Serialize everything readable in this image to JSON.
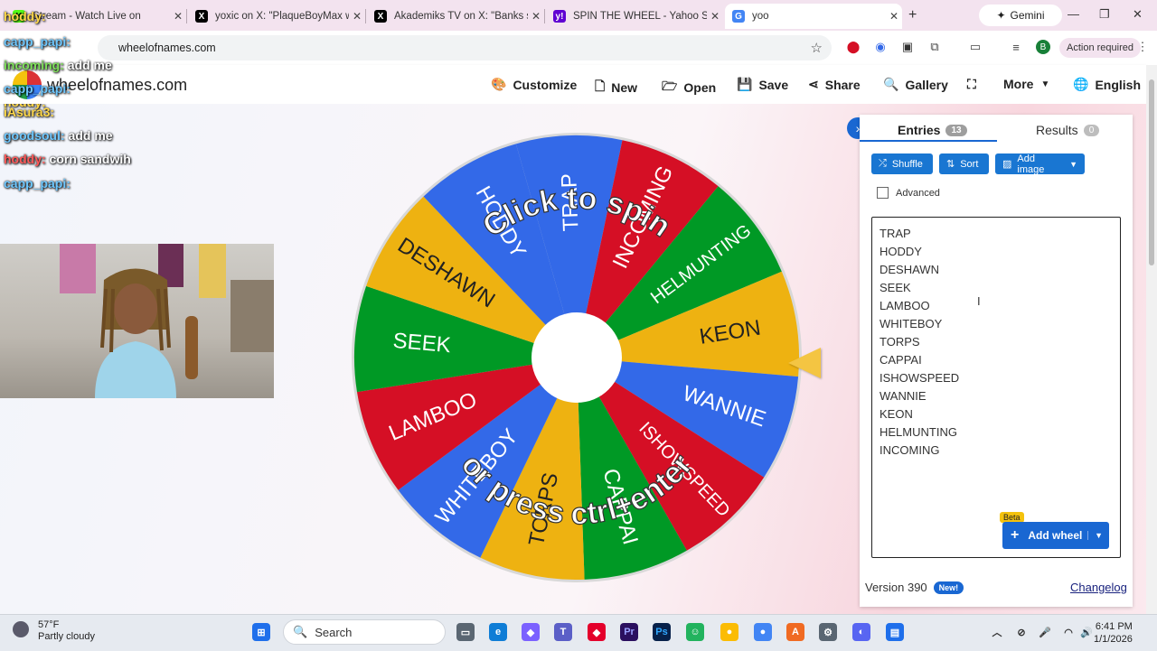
{
  "tabs": [
    {
      "title": "Stream - Watch Live on",
      "favicon": "K",
      "color": "#53fc18"
    },
    {
      "title": "yoxic on X: \"PlaqueBoyMax was",
      "favicon": "X",
      "color": "#000000"
    },
    {
      "title": "Akademiks TV on X: \"Banks spe",
      "favicon": "X",
      "color": "#000000"
    },
    {
      "title": "SPIN THE WHEEL - Yahoo Searc",
      "favicon": "y!",
      "color": "#6001d2"
    },
    {
      "title": "yoo",
      "favicon": "G",
      "color": "#4285f4"
    }
  ],
  "gemini_label": "Gemini",
  "url": "wheelofnames.com",
  "action_required": "Action required",
  "profile_initial": "B",
  "site": {
    "brand": "wheelofnames.com"
  },
  "menu": {
    "customize": "Customize",
    "new": "New",
    "open": "Open",
    "save": "Save",
    "share": "Share",
    "gallery": "Gallery",
    "more": "More",
    "language": "English"
  },
  "chat": [
    {
      "user": "hoddy:",
      "msg": ""
    },
    {
      "user": "capp_papi:",
      "msg": ""
    },
    {
      "user": "incoming:",
      "msg": "add me"
    },
    {
      "user": "capp_papi:",
      "msg": ""
    },
    {
      "user": "iAsura3:",
      "msg": ""
    },
    {
      "user": "goodsoul:",
      "msg": "add me"
    },
    {
      "user": "hoddy:",
      "msg": "corn sandwih"
    },
    {
      "user": "capp_papi:",
      "msg": ""
    }
  ],
  "wheel": {
    "overlay_top": "Click to spin",
    "overlay_bottom": "or press ctrl+enter",
    "segments": [
      "TRAP",
      "INCOMING",
      "HELMUNTING",
      "KEON",
      "WANNIE",
      "ISHOWSPEED",
      "CAPPAI",
      "TORPS",
      "WHITEBOY",
      "LAMBOO",
      "SEEK",
      "DESHAWN",
      "HODDY"
    ],
    "colors": [
      "#3369e8",
      "#d50f25",
      "#009925",
      "#eeb211"
    ]
  },
  "panel": {
    "entries_tab": "Entries",
    "entries_count": "13",
    "results_tab": "Results",
    "results_count": "0",
    "shuffle": "Shuffle",
    "sort": "Sort",
    "add_image": "Add image",
    "advanced": "Advanced",
    "entries": [
      "TRAP",
      "HODDY",
      "DESHAWN",
      "SEEK",
      "LAMBOO",
      "WHITEBOY",
      "TORPS",
      "CAPPAI",
      "ISHOWSPEED",
      "WANNIE",
      "KEON",
      "HELMUNTING",
      "INCOMING"
    ],
    "beta": "Beta",
    "add_wheel": "Add wheel",
    "version": "Version 390",
    "new_badge": "New!",
    "changelog": "Changelog"
  },
  "taskbar": {
    "temp": "57°F",
    "condition": "Partly cloudy",
    "search": "Search",
    "time": "6:41 PM",
    "date": "1/1/2026"
  }
}
